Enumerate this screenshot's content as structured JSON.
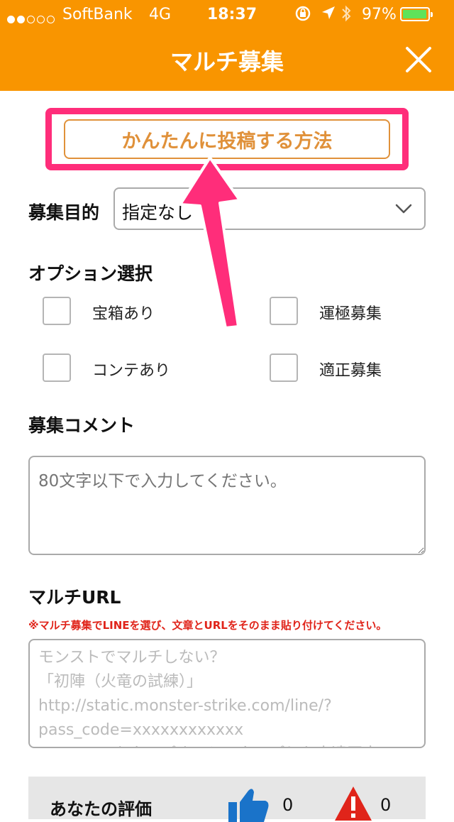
{
  "status_bar": {
    "carrier": "SoftBank",
    "network": "4G",
    "time": "18:37",
    "battery_percent": "97%",
    "battery_level": 0.97,
    "signal_bars": 2
  },
  "header": {
    "title": "マルチ募集"
  },
  "how_to": {
    "label": "かんたんに投稿する方法"
  },
  "purpose": {
    "label": "募集目的",
    "value": "指定なし"
  },
  "options": {
    "label": "オプション選択",
    "items": [
      {
        "label": "宝箱あり",
        "checked": false
      },
      {
        "label": "運極募集",
        "checked": false
      },
      {
        "label": "コンテあり",
        "checked": false
      },
      {
        "label": "適正募集",
        "checked": false
      }
    ]
  },
  "comment": {
    "label": "募集コメント",
    "placeholder": "80文字以下で入力してください。"
  },
  "multi_url": {
    "label": "マルチURL",
    "note": "※マルチ募集でLINEを選び、文章とURLをそのまま貼り付けてください。",
    "placeholder_lines": [
      "モンストでマルチしない？",
      "「初陣（火竜の試練）」",
      "http://static.monster-strike.com/line/?",
      "pass_code=xxxxxxxxxxxx",
      "↑このURLをタップすると、タップした人達同士で"
    ]
  },
  "rating": {
    "label": "あなたの評価",
    "thumbs_up_count": "0",
    "warning_count": "0"
  },
  "colors": {
    "accent": "#f99500",
    "highlight": "#ff2d7a",
    "button_text": "#e0913a",
    "note_red": "#e0241a"
  },
  "icons": [
    "close-icon",
    "chevron-down-icon",
    "thumbs-up-icon",
    "warning-icon",
    "annotation-arrow"
  ]
}
